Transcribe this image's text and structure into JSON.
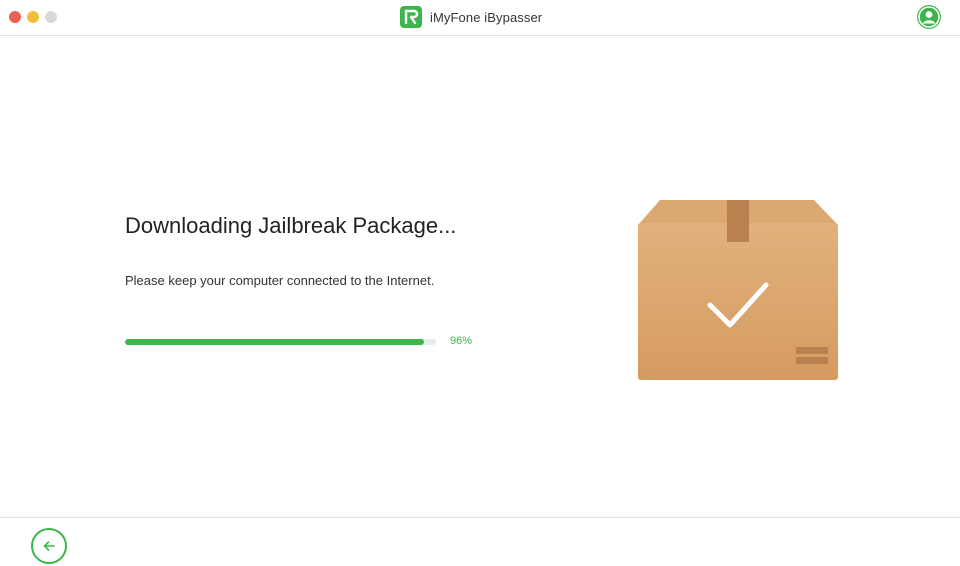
{
  "window": {
    "title": "iMyFone iBypasser",
    "controls": [
      "close",
      "minimize",
      "maximize"
    ],
    "account_icon": "user-icon"
  },
  "main": {
    "heading": "Downloading Jailbreak Package...",
    "subtext": "Please keep your computer connected to the Internet.",
    "progress": {
      "value": 0.96,
      "label": "96%"
    },
    "illustration": "package-box-checkmark-icon"
  },
  "footer": {
    "back_icon": "arrow-left-icon"
  },
  "colors": {
    "accent": "#3cb54a",
    "box": "#d9a46c",
    "close": "#ec5f57",
    "minimize": "#f0be3c",
    "maximize": "#d9d9d9"
  }
}
